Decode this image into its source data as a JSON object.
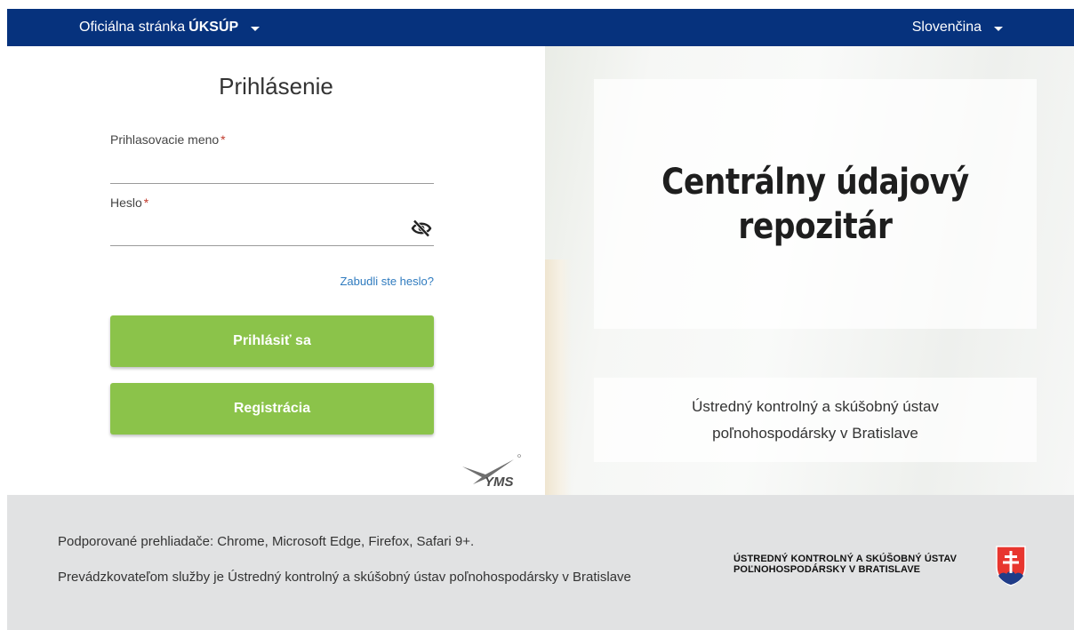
{
  "topbar": {
    "site_prefix": "Oficiálna stránka",
    "site_brand": "ÚKSÚP",
    "language": "Slovenčina",
    "background": "#06327d"
  },
  "login": {
    "title": "Prihlásenie",
    "username_label": "Prihlasovacie meno",
    "password_label": "Heslo",
    "required_mark": "*",
    "username_value": "",
    "password_value": "",
    "forgot_link": "Zabudli ste heslo?",
    "login_button": "Prihlásiť sa",
    "register_button": "Registrácia",
    "button_color": "#8bc34a",
    "vendor_logo": "YMS"
  },
  "hero": {
    "title_line1": "Centrálny údajový",
    "title_line2": "repozitár",
    "subtitle_line1": "Ústredný kontrolný a skúšobný ústav",
    "subtitle_line2": "poľnohospodársky v Bratislave"
  },
  "footer": {
    "browsers": "Podporované prehliadače: Chrome, Microsoft Edge, Firefox, Safari 9+.",
    "operator": "Prevádzkovateľom služby je Ústredný kontrolný a skúšobný ústav poľnohospodársky v Bratislave",
    "org_line1": "ÚSTREDNÝ KONTROLNÝ A SKÚŠOBNÝ ÚSTAV",
    "org_line2": "POĽNOHOSPODÁRSKY V BRATISLAVE",
    "coat_of_arms": "slovak-coat-of-arms-icon"
  }
}
